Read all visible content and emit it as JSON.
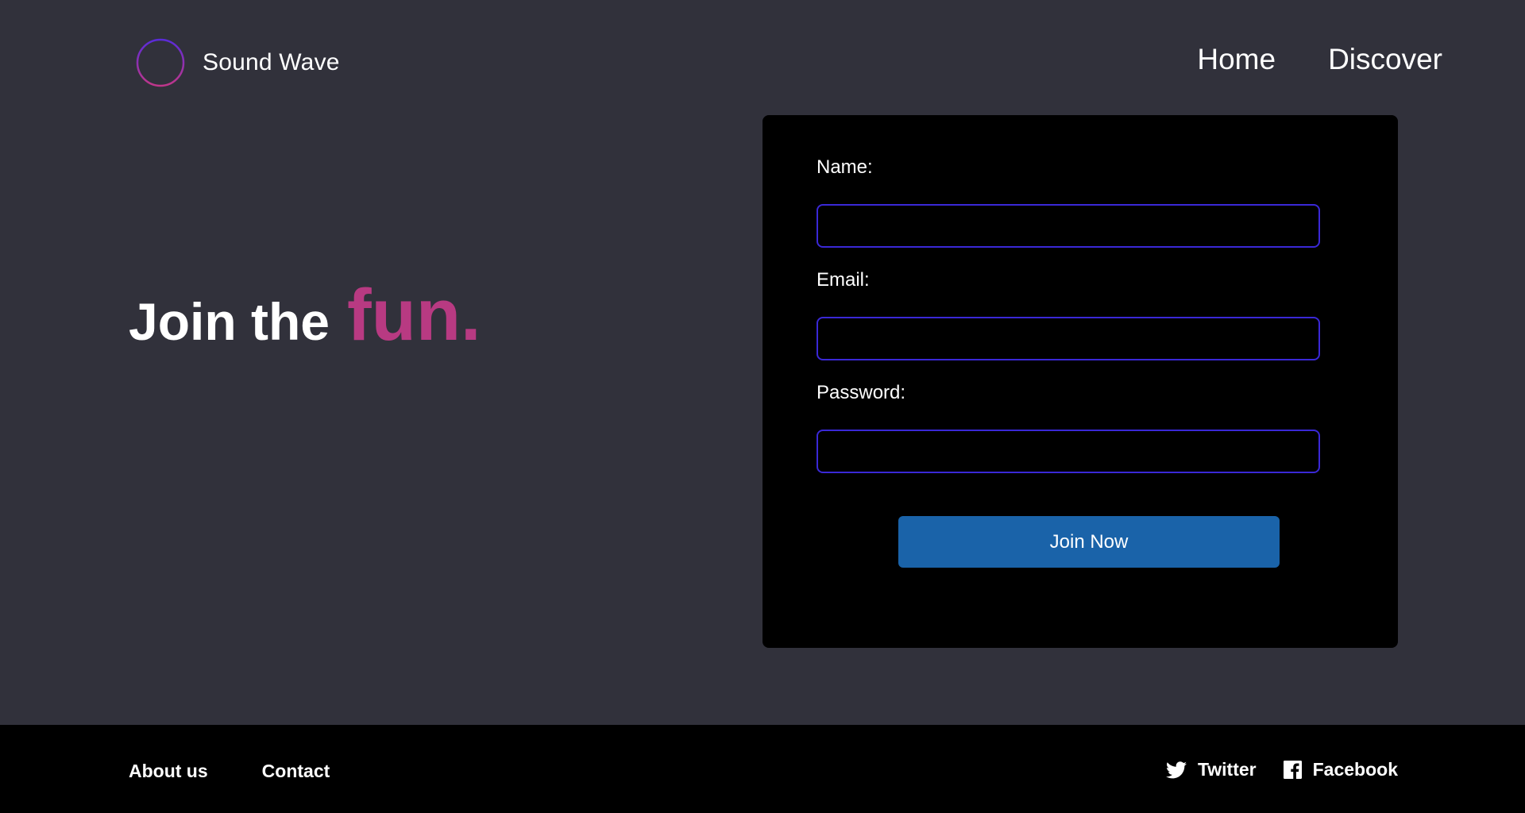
{
  "header": {
    "brand_name": "Sound Wave",
    "logo_icon": "sound-wave-logo-icon",
    "nav": [
      "Home",
      "Discover"
    ]
  },
  "hero": {
    "text": "Join the",
    "accent": "fun."
  },
  "form": {
    "name_label": "Name:",
    "name_value": "",
    "email_label": "Email:",
    "email_value": "",
    "password_label": "Password:",
    "password_value": "",
    "submit_label": "Join Now"
  },
  "footer": {
    "links": [
      "About us",
      "Contact"
    ],
    "social": [
      {
        "label": "Twitter",
        "icon": "twitter-icon"
      },
      {
        "label": "Facebook",
        "icon": "facebook-icon"
      }
    ]
  },
  "colors": {
    "background": "#31313b",
    "card": "#000000",
    "accent_pink": "#b83a82",
    "input_border": "#3a28d6",
    "button": "#1a63a9",
    "footer": "#000000"
  }
}
